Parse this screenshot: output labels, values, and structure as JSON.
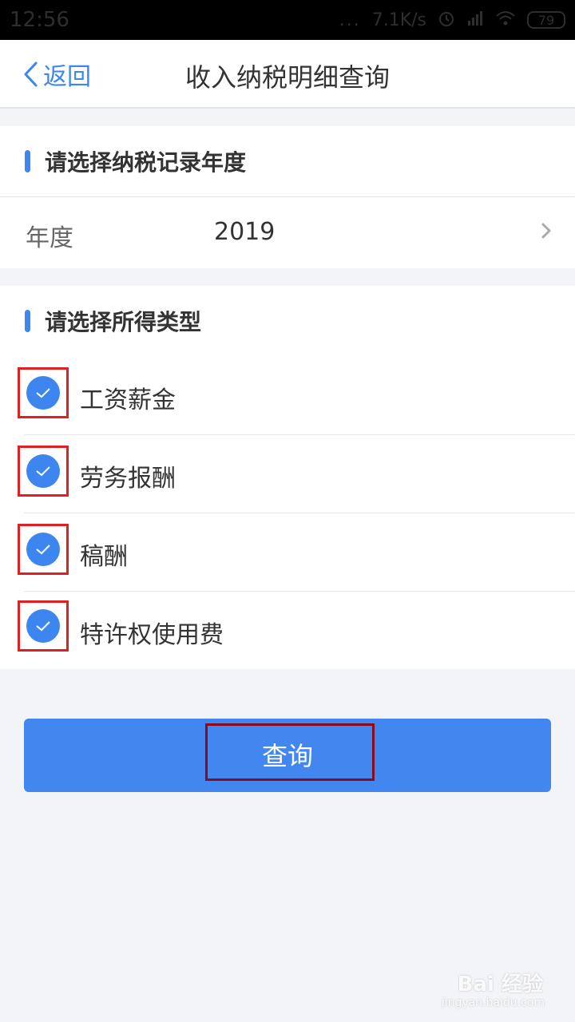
{
  "status_bar": {
    "time": "12:56",
    "dots": "...",
    "speed": "7.1K/s",
    "battery": "79",
    "icons": [
      "alarm-icon",
      "signal-icon",
      "wifi-icon",
      "battery-icon"
    ]
  },
  "nav": {
    "back_label": "返回",
    "title": "收入纳税明细查询"
  },
  "year_section": {
    "title": "请选择纳税记录年度",
    "label": "年度",
    "value": "2019"
  },
  "type_section": {
    "title": "请选择所得类型",
    "options": [
      {
        "label": "工资薪金",
        "checked": true
      },
      {
        "label": "劳务报酬",
        "checked": true
      },
      {
        "label": "稿酬",
        "checked": true
      },
      {
        "label": "特许权使用费",
        "checked": true
      }
    ]
  },
  "query_button": {
    "label": "查询"
  },
  "watermark": {
    "brand": "Bai 经验",
    "url": "jingyan.baidu.com"
  },
  "colors": {
    "accent": "#3d86f0",
    "highlight_frame": "#e02020",
    "button_frame": "#8b0b1e",
    "page_bg": "#f3f4f8"
  }
}
